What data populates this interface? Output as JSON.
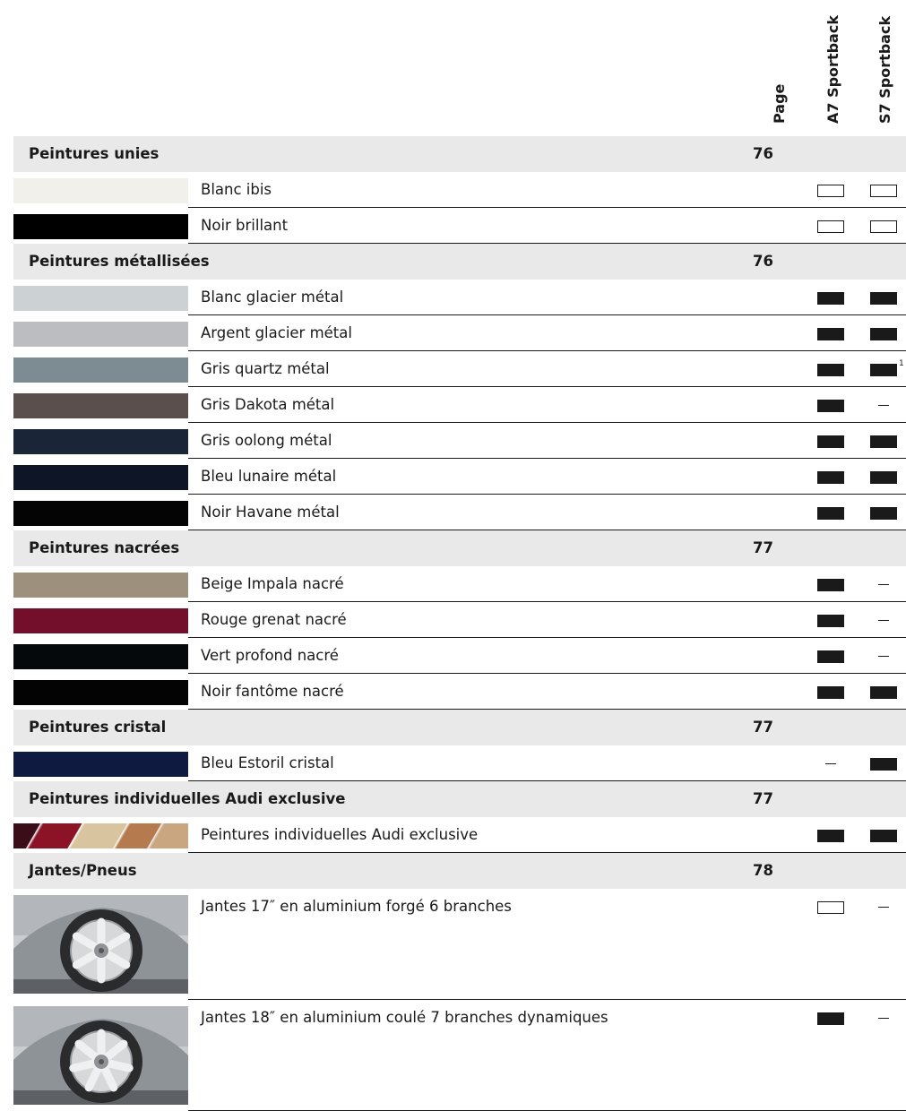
{
  "header": {
    "page_label": "Page",
    "a7_label": "A7 Sportback",
    "s7_label": "S7 Sportback"
  },
  "sections": [
    {
      "title": "Peintures unies",
      "page": "76",
      "items": [
        {
          "label": "Blanc ibis",
          "swatch": "#f1f0ea",
          "a7": "standard",
          "s7": "standard"
        },
        {
          "label": "Noir brillant",
          "swatch": "#000000",
          "a7": "standard",
          "s7": "standard"
        }
      ]
    },
    {
      "title": "Peintures métallisées",
      "page": "76",
      "items": [
        {
          "label": "Blanc glacier métal",
          "swatch": "#ccd2d4",
          "a7": "optional",
          "s7": "optional"
        },
        {
          "label": "Argent glacier métal",
          "swatch": "#bbbdc1",
          "a7": "optional",
          "s7": "optional"
        },
        {
          "label": "Gris quartz métal",
          "swatch": "#7d8c93",
          "a7": "optional",
          "s7": "optional",
          "s7_footnote": "1"
        },
        {
          "label": "Gris Dakota métal",
          "swatch": "#5a4f4d",
          "a7": "optional",
          "s7": "none"
        },
        {
          "label": "Gris oolong métal",
          "swatch": "#1a2538",
          "a7": "optional",
          "s7": "optional"
        },
        {
          "label": "Bleu lunaire métal",
          "swatch": "#0e1526",
          "a7": "optional",
          "s7": "optional"
        },
        {
          "label": "Noir Havane métal",
          "swatch": "#050404",
          "a7": "optional",
          "s7": "optional"
        }
      ]
    },
    {
      "title": "Peintures nacrées",
      "page": "77",
      "items": [
        {
          "label": "Beige Impala nacré",
          "swatch": "#9d907c",
          "a7": "optional",
          "s7": "none"
        },
        {
          "label": "Rouge grenat nacré",
          "swatch": "#730f2a",
          "a7": "optional",
          "s7": "none"
        },
        {
          "label": "Vert profond nacré",
          "swatch": "#05090b",
          "a7": "optional",
          "s7": "none"
        },
        {
          "label": "Noir fantôme nacré",
          "swatch": "#030303",
          "a7": "optional",
          "s7": "optional"
        }
      ]
    },
    {
      "title": "Peintures cristal",
      "page": "77",
      "items": [
        {
          "label": "Bleu Estoril cristal",
          "swatch": "#0f1a40",
          "a7": "none",
          "s7": "optional"
        }
      ]
    },
    {
      "title": "Peintures individuelles Audi exclusive",
      "page": "77",
      "items": [
        {
          "label": "Peintures individuelles Audi exclusive",
          "swatch": "multi",
          "a7": "optional",
          "s7": "optional"
        }
      ]
    },
    {
      "title": "Jantes/Pneus",
      "page": "78",
      "items": [
        {
          "label": "Jantes 17″ en aluminium forgé 6 branches",
          "swatch": "wheel-6-spoke",
          "a7": "standard",
          "s7": "none"
        },
        {
          "label": "Jantes 18″ en aluminium coulé 7 branches dynamiques",
          "swatch": "wheel-7-spoke",
          "a7": "optional",
          "s7": "none"
        }
      ]
    }
  ]
}
